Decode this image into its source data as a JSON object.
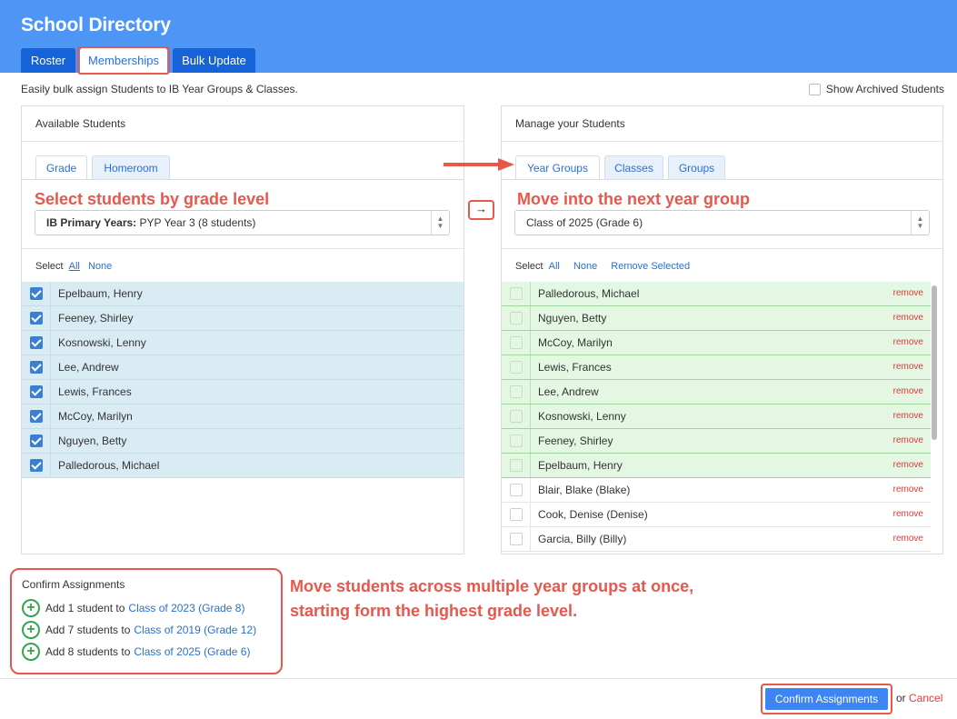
{
  "app": {
    "title": "School Directory"
  },
  "tabs": [
    {
      "label": "Roster"
    },
    {
      "label": "Memberships",
      "active": true
    },
    {
      "label": "Bulk Update"
    }
  ],
  "intro_text": "Easily bulk assign Students to IB Year Groups & Classes.",
  "show_archived": {
    "label": "Show Archived Students",
    "checked": false
  },
  "left_panel": {
    "title": "Available Students",
    "tabs": [
      {
        "label": "Grade",
        "active": true
      },
      {
        "label": "Homeroom"
      }
    ],
    "select": {
      "bold": "IB Primary Years:",
      "value": "PYP Year 3 (8 students)"
    },
    "select_label": "Select",
    "all_label": "All",
    "none_label": "None",
    "students": [
      {
        "name": "Epelbaum, Henry",
        "checked": true
      },
      {
        "name": "Feeney, Shirley",
        "checked": true
      },
      {
        "name": "Kosnowski, Lenny",
        "checked": true
      },
      {
        "name": "Lee, Andrew",
        "checked": true
      },
      {
        "name": "Lewis, Frances",
        "checked": true
      },
      {
        "name": "McCoy, Marilyn",
        "checked": true
      },
      {
        "name": "Nguyen, Betty",
        "checked": true
      },
      {
        "name": "Palledorous, Michael",
        "checked": true
      }
    ]
  },
  "right_panel": {
    "title": "Manage your Students",
    "tabs": [
      {
        "label": "Year Groups",
        "active": true
      },
      {
        "label": "Classes"
      },
      {
        "label": "Groups"
      }
    ],
    "select": {
      "value": "Class of 2025 (Grade 6)"
    },
    "select_label": "Select",
    "all_label": "All",
    "none_label": "None",
    "remove_selected_label": "Remove Selected",
    "remove_label": "remove",
    "students": [
      {
        "name": "Palledorous, Michael",
        "new": true
      },
      {
        "name": "Nguyen, Betty",
        "new": true
      },
      {
        "name": "McCoy, Marilyn",
        "new": true
      },
      {
        "name": "Lewis, Frances",
        "new": true
      },
      {
        "name": "Lee, Andrew",
        "new": true
      },
      {
        "name": "Kosnowski, Lenny",
        "new": true
      },
      {
        "name": "Feeney, Shirley",
        "new": true
      },
      {
        "name": "Epelbaum, Henry",
        "new": true
      },
      {
        "name": "Blair, Blake (Blake)",
        "new": false
      },
      {
        "name": "Cook, Denise (Denise)",
        "new": false
      },
      {
        "name": "Garcia, Billy (Billy)",
        "new": false
      }
    ]
  },
  "transfer_button": "→",
  "annotations": {
    "left": "Select students by grade level",
    "right": "Move into the next year group",
    "bottom_line1": "Move students across multiple year groups at once,",
    "bottom_line2": "starting form the highest grade level."
  },
  "confirm": {
    "title": "Confirm Assignments",
    "items": [
      {
        "text": "Add 1 student to",
        "target": "Class of 2023 (Grade 8)"
      },
      {
        "text": "Add 7 students to",
        "target": "Class of 2019 (Grade 12)"
      },
      {
        "text": "Add 8 students to",
        "target": "Class of 2025 (Grade 6)"
      }
    ]
  },
  "footer": {
    "confirm_button": "Confirm Assignments",
    "or_text": "or",
    "cancel_label": "Cancel"
  },
  "colors": {
    "header": "#4d96f6",
    "tab_dark": "#1562d9",
    "annotation": "#e8574c",
    "selected_row": "#d9ebf3",
    "new_row": "#e3f7e3",
    "remove": "#e03a3a",
    "primary_button": "#3d84f4"
  }
}
